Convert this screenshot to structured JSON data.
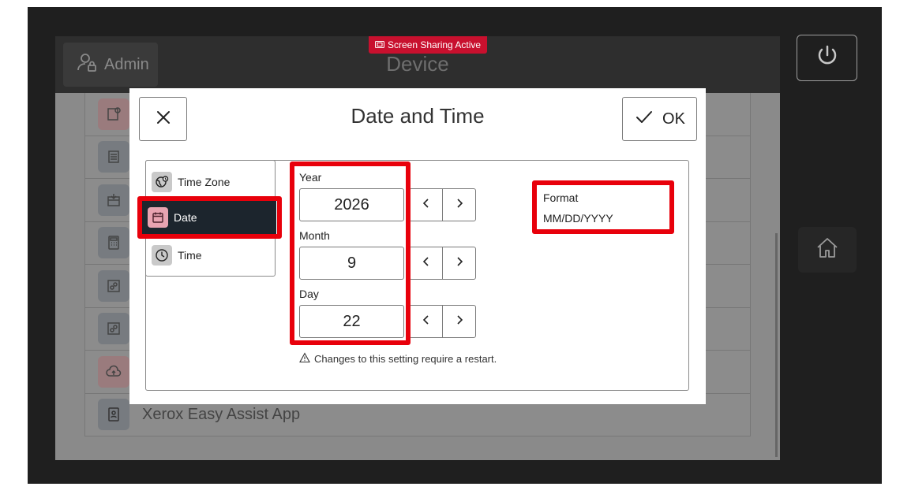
{
  "screen": {
    "admin_label": "Admin",
    "device_title": "Device",
    "share_badge": "Screen Sharing Active",
    "list_last_item": "Xerox Easy Assist App"
  },
  "dialog": {
    "title": "Date and Time",
    "ok_label": "OK",
    "nav_items": [
      {
        "label": "Time Zone",
        "icon": "globe-clock-icon"
      },
      {
        "label": "Date",
        "icon": "calendar-icon"
      },
      {
        "label": "Time",
        "icon": "clock-icon"
      }
    ],
    "selected_nav": "Date",
    "fields": {
      "year": {
        "label": "Year",
        "value": "2026"
      },
      "month": {
        "label": "Month",
        "value": "9"
      },
      "day": {
        "label": "Day",
        "value": "22"
      }
    },
    "warning": "Changes to this setting require a restart.",
    "format": {
      "label": "Format",
      "value": "MM/DD/YYYY"
    }
  },
  "colors": {
    "highlight": "#e8000b",
    "badge": "#c8102e",
    "selected_nav_bg": "#1c252d"
  }
}
